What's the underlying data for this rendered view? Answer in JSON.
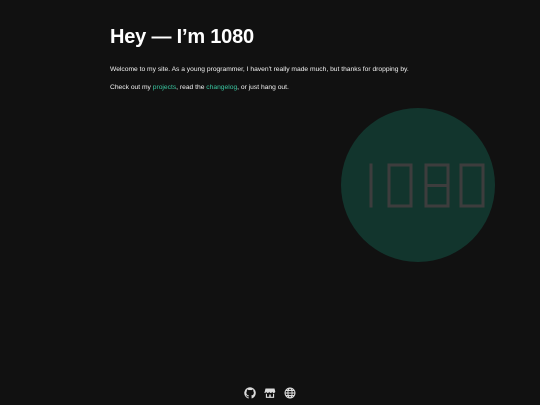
{
  "header": {
    "title": "Hey — I’m 1080"
  },
  "intro": {
    "welcome_text": "Welcome to my site. As a young programmer, I haven't really made much, but thanks for dropping by.",
    "checkout_prefix": "Check out my ",
    "projects_link": "projects",
    "read_the": ", read the ",
    "changelog_link": "changelog",
    "suffix": ", or just hang out."
  },
  "logo": {
    "text": "1080",
    "circle_color": "#12352d",
    "digit_color": "#3d3d3d"
  },
  "footer": {
    "icons": [
      "github-icon",
      "store-icon",
      "globe-icon"
    ]
  },
  "colors": {
    "background": "#111111",
    "accent": "#39c6a0",
    "text": "#ffffff"
  }
}
